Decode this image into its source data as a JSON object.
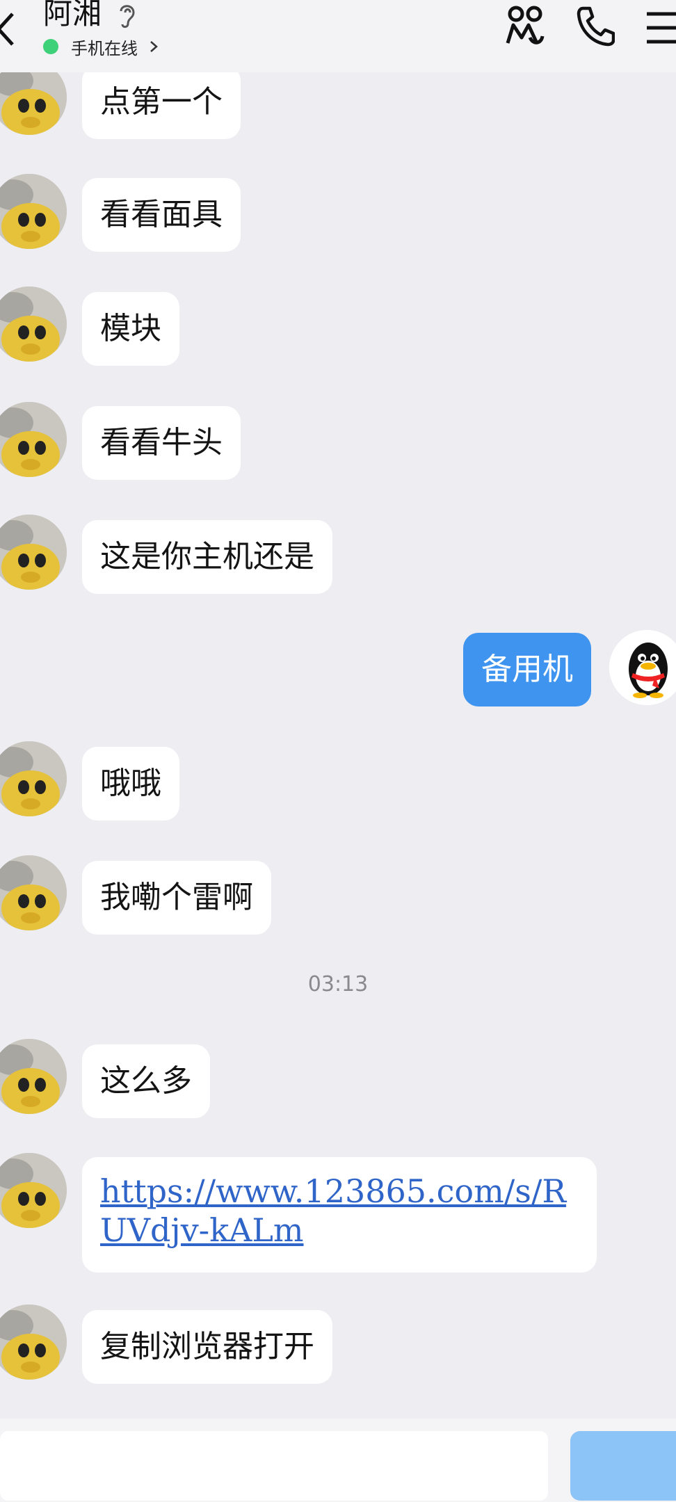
{
  "header": {
    "title": "阿湘",
    "status": "手机在线",
    "status_color": "#3fd17a"
  },
  "icons": {
    "back": "chevron-left-icon",
    "hearing": "ear-icon",
    "friends": "people-icon",
    "call": "phone-icon",
    "menu": "hamburger-menu-icon",
    "status_chevron": "chevron-right-icon"
  },
  "colors": {
    "background": "#ededf2",
    "bubble_incoming": "#ffffff",
    "bubble_outgoing": "#3f94f0",
    "link": "#2f64c8",
    "send_button": "#8cc4f7"
  },
  "messages": [
    {
      "from": "other",
      "text": "点第一个"
    },
    {
      "from": "other",
      "text": "看看面具"
    },
    {
      "from": "other",
      "text": "模块"
    },
    {
      "from": "other",
      "text": "看看牛头"
    },
    {
      "from": "other",
      "text": "这是你主机还是"
    },
    {
      "from": "me",
      "text": "备用机"
    },
    {
      "from": "other",
      "text": "哦哦"
    },
    {
      "from": "other",
      "text": "我嘞个雷啊"
    },
    {
      "from": "other",
      "text": "这么多"
    },
    {
      "from": "other",
      "text": "https://www.123865.com/s/RUVdjv-kALm",
      "type": "link"
    },
    {
      "from": "other",
      "text": "复制浏览器打开"
    }
  ],
  "timestamp": "03:13",
  "input": {
    "placeholder": "",
    "send_label": ""
  }
}
